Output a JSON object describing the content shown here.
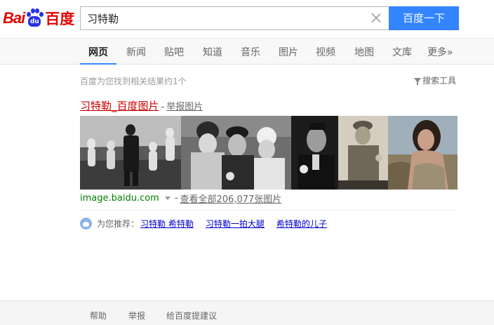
{
  "logo": {
    "part1": "Bai",
    "part2": "du",
    "cn": "百度",
    "paw_text": "du"
  },
  "search": {
    "query": "习特勒",
    "button_label": "百度一下"
  },
  "nav": {
    "items": [
      {
        "label": "网页",
        "active": true
      },
      {
        "label": "新闻"
      },
      {
        "label": "贴吧"
      },
      {
        "label": "知道"
      },
      {
        "label": "音乐"
      },
      {
        "label": "图片"
      },
      {
        "label": "视频"
      },
      {
        "label": "地图"
      },
      {
        "label": "文库"
      },
      {
        "label": "更多»"
      }
    ]
  },
  "results": {
    "count_text": "百度为您找到相关结果约1个",
    "tools_label": "搜索工具",
    "title_link": "习特勒_百度图片",
    "title_sep": "-",
    "report_link": "举报图片",
    "cite_url": "image.baidu.com",
    "cite_dash": "-",
    "view_all": "查看全部206,077张图片"
  },
  "recommend": {
    "label": "为您推荐：",
    "links": [
      "习特勒 希特勒",
      "习特勒一拍大腿",
      "希特勒的儿子"
    ]
  },
  "footer": {
    "links": [
      "帮助",
      "举报",
      "给百度提建议"
    ]
  },
  "colors": {
    "brand_red": "#e10602",
    "brand_blue": "#2932e1",
    "button_blue": "#3385ff",
    "title_red": "#cc0000",
    "link_blue": "#0000cc",
    "url_green": "#008000"
  }
}
